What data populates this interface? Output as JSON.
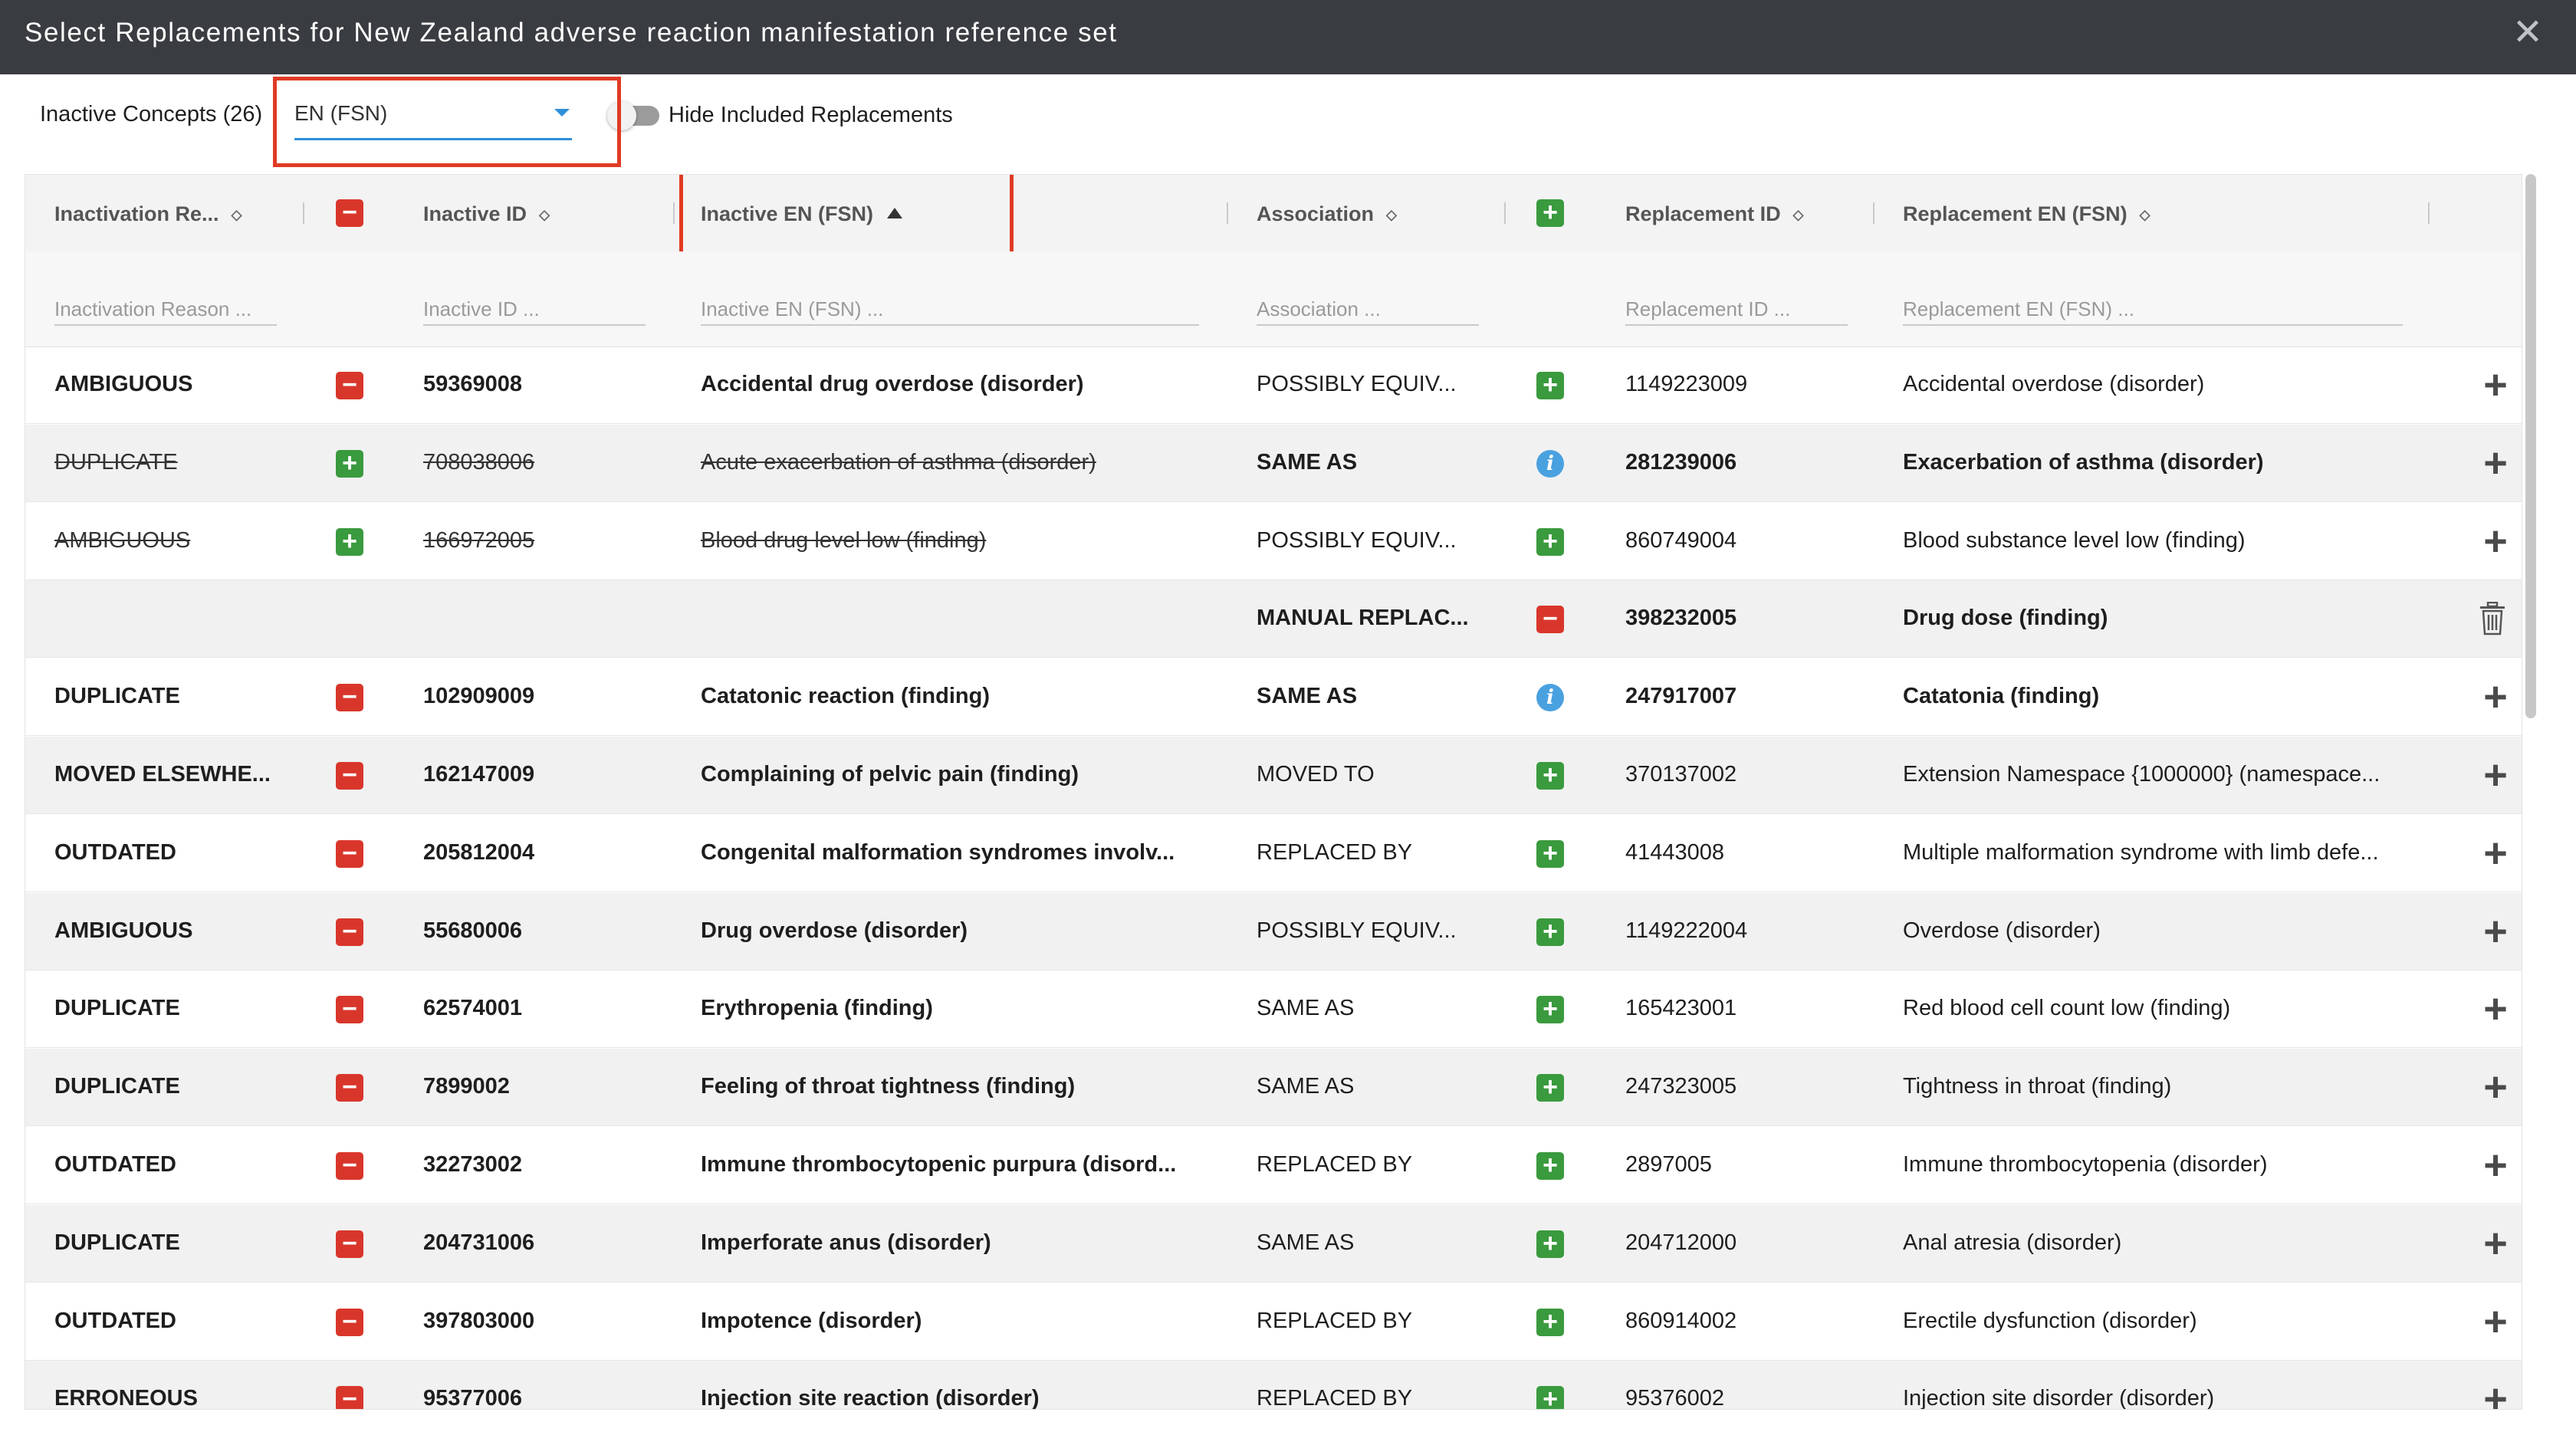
{
  "dialog": {
    "title": "Select Replacements for New Zealand adverse reaction manifestation reference set",
    "close_label": "✕"
  },
  "toolbar": {
    "concept_count": "Inactive Concepts (26)",
    "language_value": "EN (FSN)",
    "hide_label": "Hide Included Replacements",
    "hide_toggle_on": false
  },
  "columns": {
    "reason": "Inactivation Re...",
    "inactive_id": "Inactive ID",
    "inactive_fsn": "Inactive EN (FSN)",
    "association": "Association",
    "replacement_id": "Replacement ID",
    "replacement_fsn": "Replacement EN (FSN)"
  },
  "filters": {
    "reason": "Inactivation Reason ...",
    "inactive_id": "Inactive ID ...",
    "inactive_fsn": "Inactive EN (FSN) ...",
    "association": "Association ...",
    "replacement_id": "Replacement ID ...",
    "replacement_fsn": "Replacement EN (FSN) ..."
  },
  "colors": {
    "remove": "#d9362b",
    "add": "#3a9a3e",
    "info": "#4aa1e0",
    "highlight": "#e03b24",
    "titlebar": "#393c40"
  },
  "rows": [
    {
      "reason": "AMBIGUOUS",
      "inactive_id": "59369008",
      "inactive_fsn": "Accidental drug overdose (disorder)",
      "association": "POSSIBLY EQUIV...",
      "replacement_id": "1149223009",
      "replacement_fsn": "Accidental overdose (disorder)",
      "inactive_icon": "minus-icon",
      "assoc_icon": "plus-icon",
      "action": "add",
      "struck": false,
      "assoc_bold": false
    },
    {
      "reason": "DUPLICATE",
      "inactive_id": "708038006",
      "inactive_fsn": "Acute exacerbation of asthma (disorder)",
      "association": "SAME AS",
      "replacement_id": "281239006",
      "replacement_fsn": "Exacerbation of asthma (disorder)",
      "inactive_icon": "plus-icon",
      "assoc_icon": "info-icon",
      "action": "add",
      "struck": true,
      "assoc_bold": true
    },
    {
      "reason": "AMBIGUOUS",
      "inactive_id": "166972005",
      "inactive_fsn": "Blood drug level low (finding)",
      "association": "POSSIBLY EQUIV...",
      "replacement_id": "860749004",
      "replacement_fsn": "Blood substance level low (finding)",
      "inactive_icon": "plus-icon",
      "assoc_icon": "plus-icon",
      "action": "add",
      "struck": true,
      "assoc_bold": false
    },
    {
      "reason": "",
      "inactive_id": "",
      "inactive_fsn": "",
      "association": "MANUAL REPLAC...",
      "replacement_id": "398232005",
      "replacement_fsn": "Drug dose (finding)",
      "inactive_icon": "none",
      "assoc_icon": "minus-icon",
      "action": "delete",
      "struck": false,
      "assoc_bold": true
    },
    {
      "reason": "DUPLICATE",
      "inactive_id": "102909009",
      "inactive_fsn": "Catatonic reaction (finding)",
      "association": "SAME AS",
      "replacement_id": "247917007",
      "replacement_fsn": "Catatonia (finding)",
      "inactive_icon": "minus-icon",
      "assoc_icon": "info-icon",
      "action": "add",
      "struck": false,
      "assoc_bold": true
    },
    {
      "reason": "MOVED ELSEWHE...",
      "inactive_id": "162147009",
      "inactive_fsn": "Complaining of pelvic pain (finding)",
      "association": "MOVED TO",
      "replacement_id": "370137002",
      "replacement_fsn": "Extension Namespace {1000000} (namespace...",
      "inactive_icon": "minus-icon",
      "assoc_icon": "plus-icon",
      "action": "add",
      "struck": false,
      "assoc_bold": false
    },
    {
      "reason": "OUTDATED",
      "inactive_id": "205812004",
      "inactive_fsn": "Congenital malformation syndromes involv...",
      "association": "REPLACED BY",
      "replacement_id": "41443008",
      "replacement_fsn": "Multiple malformation syndrome with limb defe...",
      "inactive_icon": "minus-icon",
      "assoc_icon": "plus-icon",
      "action": "add",
      "struck": false,
      "assoc_bold": false
    },
    {
      "reason": "AMBIGUOUS",
      "inactive_id": "55680006",
      "inactive_fsn": "Drug overdose (disorder)",
      "association": "POSSIBLY EQUIV...",
      "replacement_id": "1149222004",
      "replacement_fsn": "Overdose (disorder)",
      "inactive_icon": "minus-icon",
      "assoc_icon": "plus-icon",
      "action": "add",
      "struck": false,
      "assoc_bold": false
    },
    {
      "reason": "DUPLICATE",
      "inactive_id": "62574001",
      "inactive_fsn": "Erythropenia (finding)",
      "association": "SAME AS",
      "replacement_id": "165423001",
      "replacement_fsn": "Red blood cell count low (finding)",
      "inactive_icon": "minus-icon",
      "assoc_icon": "plus-icon",
      "action": "add",
      "struck": false,
      "assoc_bold": false
    },
    {
      "reason": "DUPLICATE",
      "inactive_id": "7899002",
      "inactive_fsn": "Feeling of throat tightness (finding)",
      "association": "SAME AS",
      "replacement_id": "247323005",
      "replacement_fsn": "Tightness in throat (finding)",
      "inactive_icon": "minus-icon",
      "assoc_icon": "plus-icon",
      "action": "add",
      "struck": false,
      "assoc_bold": false
    },
    {
      "reason": "OUTDATED",
      "inactive_id": "32273002",
      "inactive_fsn": "Immune thrombocytopenic purpura (disord...",
      "association": "REPLACED BY",
      "replacement_id": "2897005",
      "replacement_fsn": "Immune thrombocytopenia (disorder)",
      "inactive_icon": "minus-icon",
      "assoc_icon": "plus-icon",
      "action": "add",
      "struck": false,
      "assoc_bold": false
    },
    {
      "reason": "DUPLICATE",
      "inactive_id": "204731006",
      "inactive_fsn": "Imperforate anus (disorder)",
      "association": "SAME AS",
      "replacement_id": "204712000",
      "replacement_fsn": "Anal atresia (disorder)",
      "inactive_icon": "minus-icon",
      "assoc_icon": "plus-icon",
      "action": "add",
      "struck": false,
      "assoc_bold": false
    },
    {
      "reason": "OUTDATED",
      "inactive_id": "397803000",
      "inactive_fsn": "Impotence (disorder)",
      "association": "REPLACED BY",
      "replacement_id": "860914002",
      "replacement_fsn": "Erectile dysfunction (disorder)",
      "inactive_icon": "minus-icon",
      "assoc_icon": "plus-icon",
      "action": "add",
      "struck": false,
      "assoc_bold": false
    },
    {
      "reason": "ERRONEOUS",
      "inactive_id": "95377006",
      "inactive_fsn": "Injection site reaction (disorder)",
      "association": "REPLACED BY",
      "replacement_id": "95376002",
      "replacement_fsn": "Injection site disorder (disorder)",
      "inactive_icon": "minus-icon",
      "assoc_icon": "plus-icon",
      "action": "add",
      "struck": false,
      "assoc_bold": false
    }
  ]
}
